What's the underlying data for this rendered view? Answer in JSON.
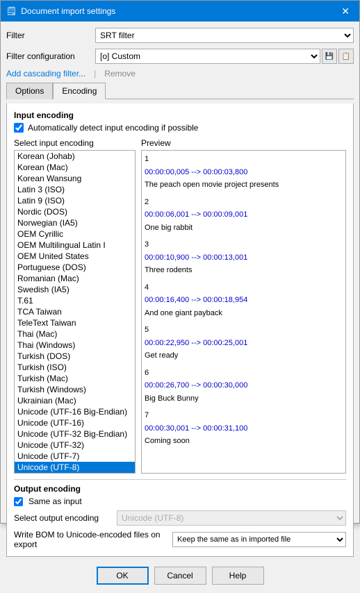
{
  "window": {
    "title": "Document import settings",
    "icon": "📄"
  },
  "filter_label": "Filter",
  "filter_value": "SRT filter",
  "filter_config_label": "Filter configuration",
  "filter_config_value": "[o] Custom",
  "add_cascading_label": "Add cascading filter...",
  "separator": "|",
  "remove_label": "Remove",
  "tabs": [
    {
      "id": "options",
      "label": "Options"
    },
    {
      "id": "encoding",
      "label": "Encoding"
    }
  ],
  "active_tab": "encoding",
  "input_encoding_section": "Input encoding",
  "auto_detect_label": "Automatically detect input encoding if possible",
  "select_input_label": "Select input encoding",
  "preview_label": "Preview",
  "encodings": [
    "Korean (Johab)",
    "Korean (Mac)",
    "Korean Wansung",
    "Latin 3 (ISO)",
    "Latin 9 (ISO)",
    "Nordic (DOS)",
    "Norwegian (IA5)",
    "OEM Cyrillic",
    "OEM Multilingual Latin I",
    "OEM United States",
    "Portuguese (DOS)",
    "Romanian (Mac)",
    "Swedish (IA5)",
    "T.61",
    "TCA Taiwan",
    "TeleText Taiwan",
    "Thai (Mac)",
    "Thai (Windows)",
    "Turkish (DOS)",
    "Turkish (ISO)",
    "Turkish (Mac)",
    "Turkish (Windows)",
    "Ukrainian (Mac)",
    "Unicode (UTF-16 Big-Endian)",
    "Unicode (UTF-16)",
    "Unicode (UTF-32 Big-Endian)",
    "Unicode (UTF-32)",
    "Unicode (UTF-7)",
    "Unicode (UTF-8)"
  ],
  "selected_encoding": "Unicode (UTF-8)",
  "preview_entries": [
    {
      "num": "1",
      "time": "00:00:00,005 --> 00:00:03,800",
      "text": "The peach open movie project presents"
    },
    {
      "num": "2",
      "time": "00:00:06,001 --> 00:00:09,001",
      "text": "One big rabbit"
    },
    {
      "num": "3",
      "time": "00:00:10,900 --> 00:00:13,001",
      "text": "Three rodents"
    },
    {
      "num": "4",
      "time": "00:00:16,400 --> 00:00:18,954",
      "text": "And one giant payback"
    },
    {
      "num": "5",
      "time": "00:00:22,950 --> 00:00:25,001",
      "text": "Get ready"
    },
    {
      "num": "6",
      "time": "00:00:26,700 --> 00:00:30,000",
      "text": "Big Buck Bunny"
    },
    {
      "num": "7",
      "time": "00:00:30,001 --> 00:00:31,100",
      "text": "Coming soon"
    }
  ],
  "output_encoding_section": "Output encoding",
  "same_as_input_label": "Same as input",
  "select_output_label": "Select output encoding",
  "output_encoding_value": "Unicode (UTF-8)",
  "bom_label": "Write BOM to Unicode-encoded files on export",
  "bom_value": "Keep the same as in imported file",
  "buttons": {
    "ok": "OK",
    "cancel": "Cancel",
    "help": "Help"
  }
}
